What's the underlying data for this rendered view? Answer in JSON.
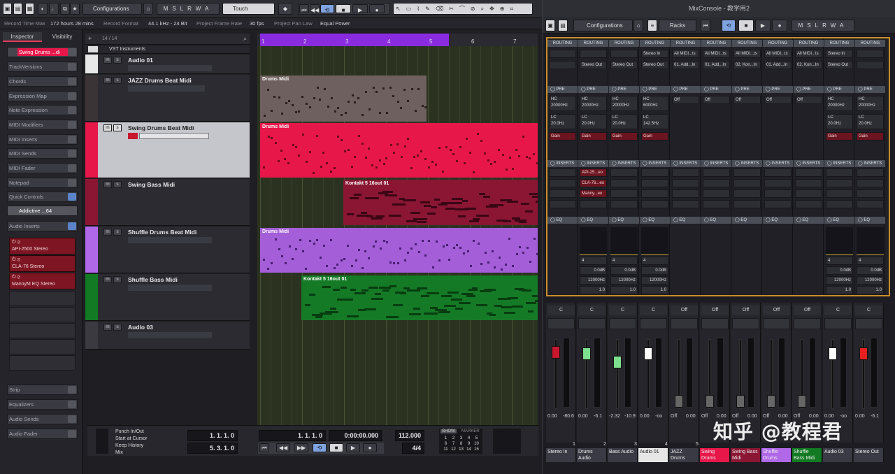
{
  "toolbar": {
    "configurations": "Configurations",
    "msrwa": [
      "M",
      "S",
      "L",
      "R",
      "W",
      "A"
    ],
    "automation_mode": "Touch"
  },
  "status": {
    "rec_time_label": "Record Time Max",
    "rec_time": "172 hours 28 mins",
    "rec_format_label": "Record Format",
    "rec_format": "44.1 kHz - 24 Bit",
    "frame_label": "Project Frame Rate",
    "frame": "30 fps",
    "pan_label": "Project Pan Law",
    "pan": "Equal Power"
  },
  "inspector": {
    "tab_inspector": "Inspector",
    "tab_visibility": "Visibility",
    "track_name": "Swing Drums ...di",
    "sections": [
      "TrackVersions",
      "Chords",
      "Expression Map",
      "Note Expression",
      "MIDI Modifiers",
      "MIDI Inserts",
      "MIDI Sends",
      "MIDI Fader",
      "Notepad",
      "Quick Controls"
    ],
    "instrument": "Addictive ...64",
    "audio_inserts": "Audio Inserts",
    "plugins": [
      "API-2500 Stereo",
      "CLA-76 Stereo",
      "MannyM EQ Stereo"
    ],
    "bottom_sections": [
      "Strip",
      "Equalizers",
      "Audio Sends",
      "Audio Fader"
    ]
  },
  "tracklist": {
    "count": "14 / 14",
    "folder": "VST Instruments",
    "tracks": [
      {
        "name": "Audio 01",
        "color": "#e8e8e8"
      },
      {
        "name": "JAZZ Drums Beat Midi",
        "color": "#3a3436"
      },
      {
        "name": "Swing Drums Beat Midi",
        "color": "#e8174a"
      },
      {
        "name": "Swing Bass Midi",
        "color": "#8a1633"
      },
      {
        "name": "Shuffle Drums Beat Midi",
        "color": "#b067e8"
      },
      {
        "name": "Shuffle Bass Midi",
        "color": "#127a22"
      },
      {
        "name": "Audio 03",
        "color": "#3a3a40"
      }
    ]
  },
  "ruler": [
    "1",
    "2",
    "3",
    "4",
    "5",
    "6",
    "7"
  ],
  "events": {
    "jazz": "Drums Midi",
    "swing": "Drums Midi",
    "bass": "Kontakt 5 16out 01",
    "shuffle": "Drums Midi",
    "shuffle_bass": "Kontakt 5 16out 01"
  },
  "transport": {
    "punch_in": "Punch In/Out",
    "start_cursor": "Start at Cursor",
    "keep_history": "Keep History",
    "mix": "Mix",
    "left_locator": "1. 1. 1.  0",
    "right_locator": "5. 3. 1.  0",
    "position": "1. 1. 1.  0",
    "time": "0:00:00.000",
    "tempo": "112.000",
    "signature": "4/4",
    "show": "SHOW",
    "marker": "MARKER",
    "marker_keys": [
      "1",
      "2",
      "3",
      "4",
      "5",
      "6",
      "7",
      "8",
      "9",
      "10",
      "11",
      "12",
      "13",
      "14",
      "15"
    ]
  },
  "mixer": {
    "title": "MixConsole - 教学用2",
    "configurations": "Configurations",
    "racks": "Racks",
    "msrwa": [
      "M",
      "S",
      "L",
      "R",
      "W",
      "A"
    ],
    "routing_label": "ROUTING",
    "pre_label": "PRE",
    "inserts_label": "INSERTS",
    "eq_label": "EQ",
    "hc_label": "HC",
    "lc_label": "LC",
    "gain_label": "Gain",
    "off_label": "Off",
    "c_label": "C",
    "columns": [
      {
        "in": "",
        "out": "",
        "hc": "20000Hz",
        "lc": "20.0Hz",
        "eq": "",
        "db": "",
        "freq": "",
        "q": ""
      },
      {
        "in": "",
        "out": "Stereo Out",
        "hc": "20000Hz",
        "lc": "20.0Hz",
        "eq": "4",
        "db": "0.0dB",
        "freq": "12000Hz",
        "q": "1.0"
      },
      {
        "in": "",
        "out": "Stereo Out",
        "hc": "20000Hz",
        "lc": "20.0Hz",
        "eq": "4",
        "db": "0.0dB",
        "freq": "12000Hz",
        "q": "1.0"
      },
      {
        "in": "Stereo In",
        "out": "Stereo Out",
        "hc": "6000Hz",
        "lc": "142.5Hz",
        "eq": "4",
        "db": "0.0dB",
        "freq": "12000Hz",
        "q": "1.0"
      },
      {
        "in": "All MIDI...ts",
        "out": "01. Add...In",
        "hc": "",
        "lc": "",
        "eq": "",
        "db": "",
        "freq": "",
        "q": ""
      },
      {
        "in": "All MIDI...ts",
        "out": "01. Add...In",
        "hc": "",
        "lc": "",
        "eq": "",
        "db": "",
        "freq": "",
        "q": ""
      },
      {
        "in": "All MIDI...ts",
        "out": "02. Kon...In",
        "hc": "",
        "lc": "",
        "eq": "",
        "db": "",
        "freq": "",
        "q": ""
      },
      {
        "in": "All MIDI...ts",
        "out": "01. Add...In",
        "hc": "",
        "lc": "",
        "eq": "",
        "db": "",
        "freq": "",
        "q": ""
      },
      {
        "in": "All MIDI...ts",
        "out": "02. Kon...In",
        "hc": "",
        "lc": "",
        "eq": "",
        "db": "",
        "freq": "",
        "q": ""
      },
      {
        "in": "Stereo In",
        "out": "Stereo Out",
        "hc": "20000Hz",
        "lc": "20.0Hz",
        "eq": "4",
        "db": "0.0dB",
        "freq": "12000Hz",
        "q": "1.0"
      },
      {
        "in": "",
        "out": "",
        "hc": "20000Hz",
        "lc": "20.0Hz",
        "eq": "4",
        "db": "0.0dB",
        "freq": "12000Hz",
        "q": "1.0"
      }
    ],
    "inserts_plugins": [
      "API-25...eo",
      "CLA-76...eo",
      "Manny...eo"
    ],
    "channels": [
      {
        "name": "Stereo In",
        "color": "#3a3a44",
        "fader": "0.00",
        "peak": "-80.6"
      },
      {
        "name": "Drums Audio",
        "color": "#3a3a44",
        "fader": "0.00",
        "peak": "-6.1"
      },
      {
        "name": "Bass Audio",
        "color": "#3a3a44",
        "fader": "-2.32",
        "peak": "-10.9"
      },
      {
        "name": "Audio 01",
        "color": "#e6e6e6",
        "fader": "0.00",
        "peak": "-oo"
      },
      {
        "name": "JAZZ Drums",
        "color": "#3a3a44",
        "fader": "Off",
        "peak": "0.00"
      },
      {
        "name": "Swing Drums",
        "color": "#e8174a",
        "fader": "Off",
        "peak": "0.00"
      },
      {
        "name": "Swing Bass Midi",
        "color": "#8a1633",
        "fader": "Off",
        "peak": "0.00"
      },
      {
        "name": "Shuffle Drums",
        "color": "#b067e8",
        "fader": "Off",
        "peak": "0.00"
      },
      {
        "name": "Shuffle Bass Midi",
        "color": "#127a22",
        "fader": "Off",
        "peak": "0.00"
      },
      {
        "name": "Audio 03",
        "color": "#3a3a44",
        "fader": "0.00",
        "peak": "-oo"
      },
      {
        "name": "Stereo Out",
        "color": "#3a3a44",
        "fader": "0.00",
        "peak": "-6.1"
      }
    ],
    "channel_numbers": [
      "1",
      "2",
      "3",
      "4",
      "5"
    ]
  },
  "watermark": "知乎 @教程君"
}
